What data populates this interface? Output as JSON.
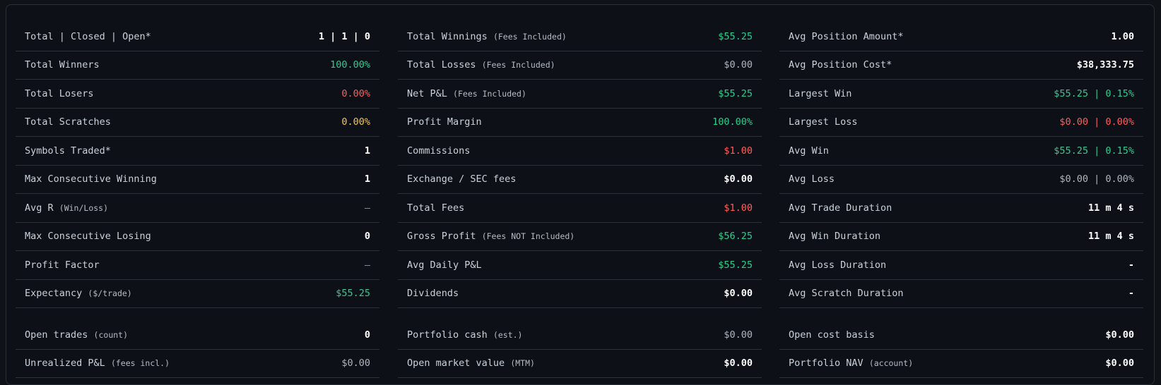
{
  "colors": {
    "background": "#0d1117",
    "divider": "#2b3139",
    "green": "#2ecc8f",
    "red": "#ff5c5c",
    "yellow": "#f5c542",
    "white": "#ffffff",
    "gray": "#aeb5bd"
  },
  "columns": [
    {
      "rows": [
        {
          "label": "Total | Closed | Open*",
          "sub": "",
          "value": "1 | 1 | 0",
          "tone": "white"
        },
        {
          "label": "Total Winners",
          "sub": "",
          "value": "100.00%",
          "tone": "green"
        },
        {
          "label": "Total Losers",
          "sub": "",
          "value": "0.00%",
          "tone": "red"
        },
        {
          "label": "Total Scratches",
          "sub": "",
          "value": "0.00%",
          "tone": "yellow"
        },
        {
          "label": "Symbols Traded*",
          "sub": "",
          "value": "1",
          "tone": "white"
        },
        {
          "label": "Max Consecutive Winning",
          "sub": "",
          "value": "1",
          "tone": "white"
        },
        {
          "label": "Avg R",
          "sub": "(Win/Loss)",
          "value": "—",
          "tone": "dash"
        },
        {
          "label": "Max Consecutive Losing",
          "sub": "",
          "value": "0",
          "tone": "white"
        },
        {
          "label": "Profit Factor",
          "sub": "",
          "value": "—",
          "tone": "dash"
        },
        {
          "label": "Expectancy",
          "sub": "($/trade)",
          "value": "$55.25",
          "tone": "green"
        },
        {
          "label": "Open trades",
          "sub": "(count)",
          "value": "0",
          "tone": "white"
        },
        {
          "label": "Unrealized P&L",
          "sub": "(fees incl.)",
          "value": "$0.00",
          "tone": "gray"
        }
      ]
    },
    {
      "rows": [
        {
          "label": "Total Winnings",
          "sub": "(Fees Included)",
          "value": "$55.25",
          "tone": "green"
        },
        {
          "label": "Total Losses",
          "sub": "(Fees Included)",
          "value": "$0.00",
          "tone": "gray"
        },
        {
          "label": "Net P&L",
          "sub": "(Fees Included)",
          "value": "$55.25",
          "tone": "green"
        },
        {
          "label": "Profit Margin",
          "sub": "",
          "value": "100.00%",
          "tone": "green"
        },
        {
          "label": "Commissions",
          "sub": "",
          "value": "$1.00",
          "tone": "red"
        },
        {
          "label": "Exchange / SEC fees",
          "sub": "",
          "value": "$0.00",
          "tone": "white"
        },
        {
          "label": "Total Fees",
          "sub": "",
          "value": "$1.00",
          "tone": "red"
        },
        {
          "label": "Gross Profit",
          "sub": "(Fees NOT Included)",
          "value": "$56.25",
          "tone": "green"
        },
        {
          "label": "Avg Daily P&L",
          "sub": "",
          "value": "$55.25",
          "tone": "green"
        },
        {
          "label": "Dividends",
          "sub": "",
          "value": "$0.00",
          "tone": "white"
        },
        {
          "label": "Portfolio cash",
          "sub": "(est.)",
          "value": "$0.00",
          "tone": "gray"
        },
        {
          "label": "Open market value",
          "sub": "(MTM)",
          "value": "$0.00",
          "tone": "white"
        }
      ]
    },
    {
      "rows": [
        {
          "label": "Avg Position Amount*",
          "sub": "",
          "value": "1.00",
          "tone": "white"
        },
        {
          "label": "Avg Position Cost*",
          "sub": "",
          "value": "$38,333.75",
          "tone": "white"
        },
        {
          "label": "Largest Win",
          "sub": "",
          "value": "$55.25 | 0.15%",
          "tone": "green"
        },
        {
          "label": "Largest Loss",
          "sub": "",
          "value": "$0.00 | 0.00%",
          "tone": "red"
        },
        {
          "label": "Avg Win",
          "sub": "",
          "value": "$55.25 | 0.15%",
          "tone": "green"
        },
        {
          "label": "Avg Loss",
          "sub": "",
          "value": "$0.00 | 0.00%",
          "tone": "gray"
        },
        {
          "label": "Avg Trade Duration",
          "sub": "",
          "value": "11 m 4 s",
          "tone": "white"
        },
        {
          "label": "Avg Win Duration",
          "sub": "",
          "value": "11 m 4 s",
          "tone": "white"
        },
        {
          "label": "Avg Loss Duration",
          "sub": "",
          "value": "-",
          "tone": "white"
        },
        {
          "label": "Avg Scratch Duration",
          "sub": "",
          "value": "-",
          "tone": "white"
        },
        {
          "label": "Open cost basis",
          "sub": "",
          "value": "$0.00",
          "tone": "white"
        },
        {
          "label": "Portfolio NAV",
          "sub": "(account)",
          "value": "$0.00",
          "tone": "white"
        }
      ]
    }
  ]
}
